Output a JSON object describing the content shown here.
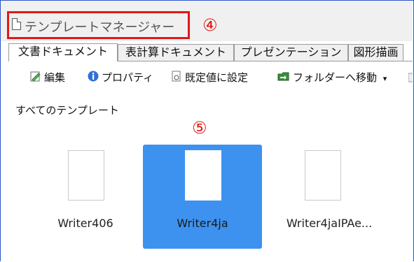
{
  "window": {
    "title": "テンプレートマネージャー",
    "marker_title": "④",
    "marker_selection": "⑤"
  },
  "tabs": [
    {
      "label": "文書ドキュメント",
      "active": true
    },
    {
      "label": "表計算ドキュメント",
      "active": false
    },
    {
      "label": "プレゼンテーション",
      "active": false
    },
    {
      "label": "図形描画",
      "active": false
    }
  ],
  "toolbar": {
    "edit": "編集",
    "properties": "プロパティ",
    "set_default": "既定値に設定",
    "move_to_folder": "フォルダーへ移動",
    "dropdown_arrow": "▾"
  },
  "section": {
    "title": "すべてのテンプレート"
  },
  "templates": [
    {
      "name": "Writer406",
      "selected": false
    },
    {
      "name": "Writer4ja",
      "selected": true
    },
    {
      "name": "Writer4jaIPAe...",
      "selected": false
    }
  ],
  "colors": {
    "selection": "#3d92f0",
    "highlight_box": "#e21717",
    "marker": "#e21717"
  }
}
